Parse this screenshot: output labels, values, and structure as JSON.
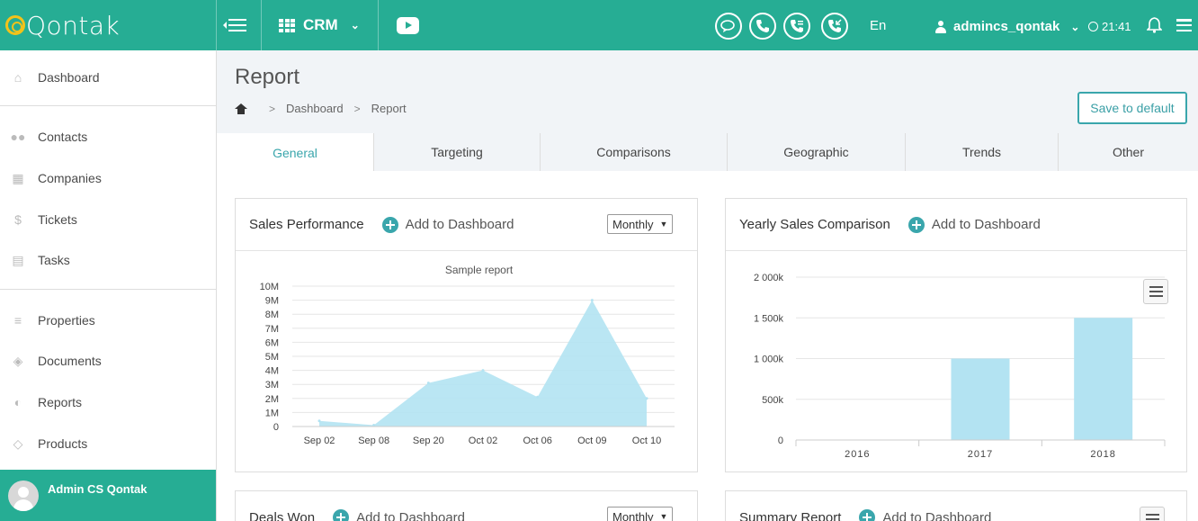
{
  "app": {
    "logo_text": "Qontak"
  },
  "topbar": {
    "module": "CRM",
    "language": "En",
    "username": "admincs_qontak",
    "time": "21:41",
    "icons": [
      "menu-toggle-icon",
      "grid-icon",
      "youtube-icon",
      "chat-icon",
      "phone-icon",
      "phone-forward-icon",
      "phone-incoming-icon",
      "user-icon",
      "clock-icon",
      "bell-icon",
      "hamburger-icon"
    ]
  },
  "sidebar": {
    "items": [
      {
        "label": "Dashboard",
        "icon": "home-icon"
      },
      {
        "label": "Contacts",
        "icon": "people-icon"
      },
      {
        "label": "Companies",
        "icon": "building-icon"
      },
      {
        "label": "Tickets",
        "icon": "dollar-icon"
      },
      {
        "label": "Tasks",
        "icon": "calendar-icon"
      },
      {
        "label": "Properties",
        "icon": "list-icon"
      },
      {
        "label": "Documents",
        "icon": "layers-icon"
      },
      {
        "label": "Reports",
        "icon": "pie-chart-icon"
      },
      {
        "label": "Products",
        "icon": "tag-icon"
      }
    ],
    "user_name": "Admin CS Qontak"
  },
  "page": {
    "title": "Report",
    "breadcrumb": [
      "Dashboard",
      "Report"
    ],
    "save_button": "Save to default"
  },
  "tabs": [
    "General",
    "Targeting",
    "Comparisons",
    "Geographic",
    "Trends",
    "Other"
  ],
  "active_tab": "General",
  "cards": {
    "sales": {
      "title": "Sales Performance",
      "add_label": "Add to Dashboard",
      "period": "Monthly"
    },
    "yearly": {
      "title": "Yearly Sales Comparison",
      "add_label": "Add to Dashboard"
    },
    "deals": {
      "title": "Deals Won",
      "add_label": "Add to Dashboard",
      "period": "Monthly"
    },
    "summary": {
      "title": "Summary Report",
      "add_label": "Add to Dashboard"
    }
  },
  "colors": {
    "accent": "#26ad94",
    "chart_fill": "#b3e3f2"
  },
  "chart_data": [
    {
      "type": "area",
      "title": "Sample report",
      "x": [
        "Sep 02",
        "Sep 08",
        "Sep 20",
        "Oct 02",
        "Oct 06",
        "Oct 09",
        "Oct 10"
      ],
      "yticks": [
        "0",
        "1M",
        "2M",
        "3M",
        "4M",
        "5M",
        "6M",
        "7M",
        "8M",
        "9M",
        "10M"
      ],
      "values": [
        400000,
        100000,
        3100000,
        4000000,
        2100000,
        9000000,
        2000000
      ],
      "ylim": [
        0,
        10000000
      ],
      "grid": true
    },
    {
      "type": "bar",
      "categories": [
        "2016",
        "2017",
        "2018"
      ],
      "values": [
        0,
        1000000,
        1500000
      ],
      "yticks": [
        "0",
        "500k",
        "1 000k",
        "1 500k",
        "2 000k"
      ],
      "ylim": [
        0,
        2000000
      ],
      "grid": true
    }
  ]
}
